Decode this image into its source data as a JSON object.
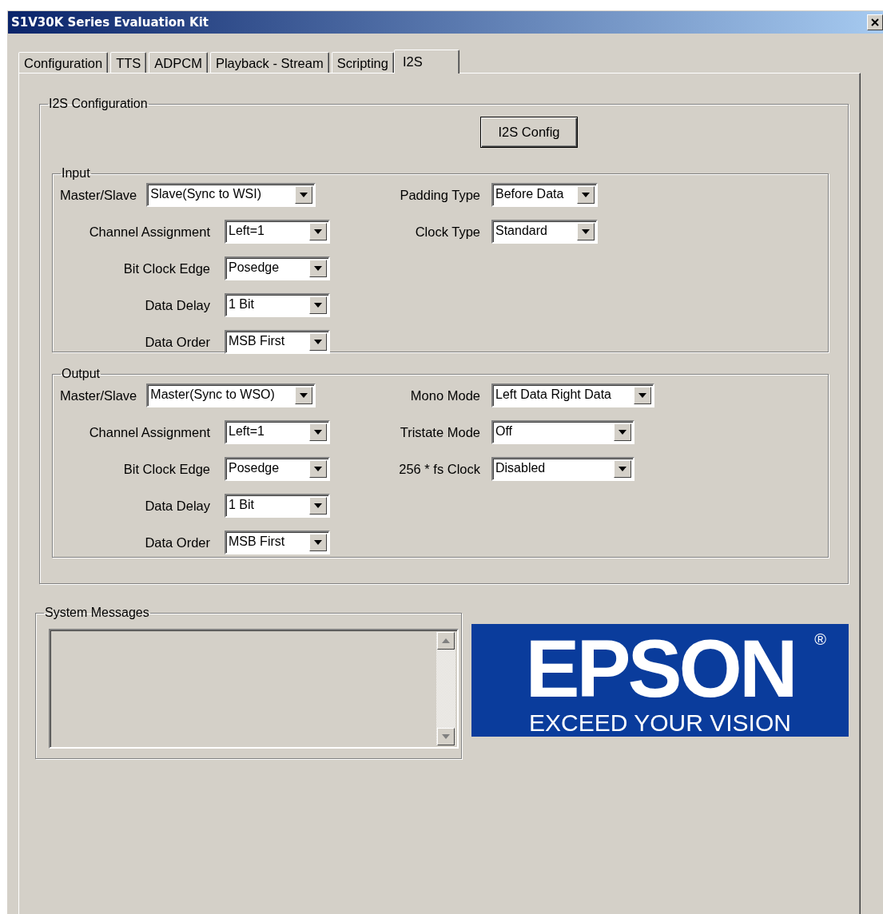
{
  "window": {
    "title": "S1V30K Series Evaluation Kit"
  },
  "tabs": [
    {
      "label": "Configuration",
      "selected": false
    },
    {
      "label": "TTS",
      "selected": false
    },
    {
      "label": "ADPCM",
      "selected": false
    },
    {
      "label": "Playback - Stream",
      "selected": false
    },
    {
      "label": "Scripting",
      "selected": false
    },
    {
      "label": "I2S",
      "selected": true
    }
  ],
  "i2s_configuration": {
    "title": "I2S Configuration",
    "button": "I2S Config",
    "groups": [
      {
        "title": "Input",
        "left": [
          {
            "label": "Master/Slave",
            "value": "Slave(Sync to WSI)"
          },
          {
            "label": "Channel Assignment",
            "value": "Left=1"
          },
          {
            "label": "Bit Clock Edge",
            "value": "Posedge"
          },
          {
            "label": "Data Delay",
            "value": "1 Bit"
          },
          {
            "label": "Data Order",
            "value": "MSB First"
          }
        ],
        "right": [
          {
            "label": "Padding Type",
            "value": "Before Data"
          },
          {
            "label": "Clock Type",
            "value": "Standard"
          }
        ]
      },
      {
        "title": "Output",
        "left": [
          {
            "label": "Master/Slave",
            "value": "Master(Sync to WSO)"
          },
          {
            "label": "Channel Assignment",
            "value": "Left=1"
          },
          {
            "label": "Bit Clock Edge",
            "value": "Posedge"
          },
          {
            "label": "Data Delay",
            "value": "1 Bit"
          },
          {
            "label": "Data Order",
            "value": "MSB First"
          }
        ],
        "right": [
          {
            "label": "Mono Mode",
            "value": "Left Data Right Data"
          },
          {
            "label": "Tristate Mode",
            "value": "Off"
          },
          {
            "label": "256 * fs Clock",
            "value": "Disabled"
          }
        ]
      }
    ]
  },
  "system_messages": {
    "title": "System Messages"
  },
  "logo": {
    "brand": "EPSON",
    "mark": "®",
    "tagline": "EXCEED YOUR VISION"
  }
}
